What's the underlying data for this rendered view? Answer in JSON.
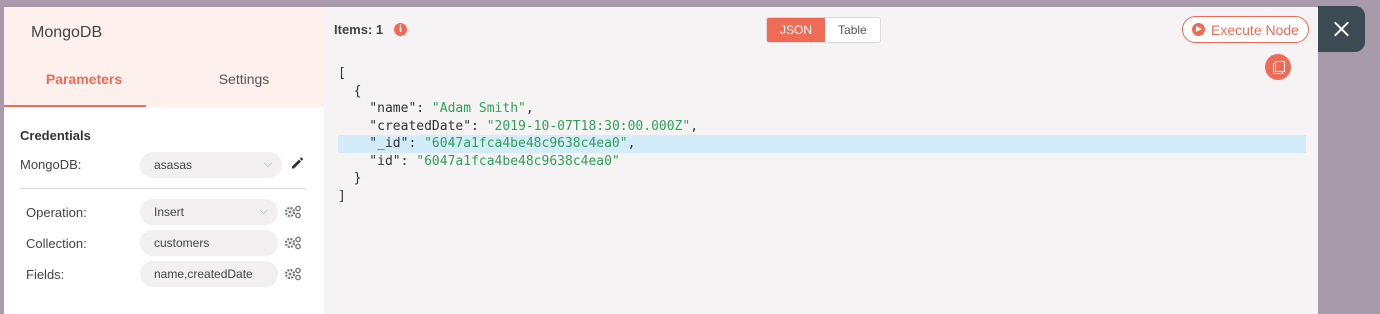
{
  "node": {
    "title": "MongoDB",
    "tabs": [
      "Parameters",
      "Settings"
    ]
  },
  "credentials": {
    "section_title": "Credentials",
    "label": "MongoDB:",
    "value": "asasas"
  },
  "params": [
    {
      "label": "Operation:",
      "value": "Insert",
      "type": "select"
    },
    {
      "label": "Collection:",
      "value": "customers",
      "type": "text"
    },
    {
      "label": "Fields:",
      "value": "name,createdDate",
      "type": "text"
    }
  ],
  "output": {
    "items_label": "Items: 1",
    "info_glyph": "i",
    "view_tabs": [
      "JSON",
      "Table"
    ],
    "execute_label": "Execute Node",
    "json_lines": [
      {
        "text": "[",
        "value": ""
      },
      {
        "text": "  {",
        "value": ""
      },
      {
        "text": "    \"name\": ",
        "value": "\"Adam Smith\"",
        "tail": ","
      },
      {
        "text": "    \"createdDate\": ",
        "value": "\"2019-10-07T18:30:00.000Z\"",
        "tail": ","
      },
      {
        "text": "    \"_id\": ",
        "value": "\"6047a1fca4be48c9638c4ea0\"",
        "tail": ","
      },
      {
        "text": "    \"id\": ",
        "value": "\"6047a1fca4be48c9638c4ea0\"",
        "tail": ""
      },
      {
        "text": "  }",
        "value": ""
      },
      {
        "text": "]",
        "value": ""
      }
    ]
  },
  "colors": {
    "accent": "#f06b55",
    "string": "#2fa15a",
    "highlight": "#d4ebfa",
    "backdrop": "#a99aab",
    "close_bg": "#3c4a54"
  },
  "icons": [
    "info-icon",
    "chevron-down-icon",
    "pencil-icon",
    "gear-icon",
    "play-icon",
    "copy-icon",
    "close-icon"
  ]
}
